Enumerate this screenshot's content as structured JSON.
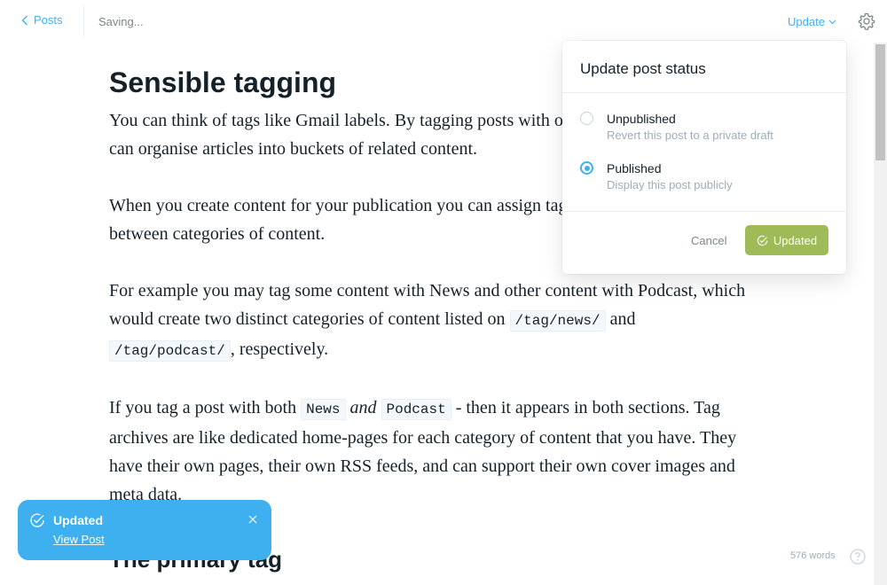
{
  "header": {
    "back_label": "Posts",
    "status_text": "Saving...",
    "update_label": "Update"
  },
  "post": {
    "title": "Sensible tagging",
    "paragraphs": {
      "p1": "You can think of tags like Gmail labels. By tagging posts with one or more keywords, you can organise articles into buckets of related content.",
      "p2": "When you create content for your publication you can assign tags to help differentiate between categories of content.",
      "p3_a": "For example you may tag some content with News and other content with Podcast, which would create two distinct categories of content listed on ",
      "p3_code1": "/tag/news/",
      "p3_b": " and ",
      "p3_code2": "/tag/podcast/",
      "p3_c": ", respectively.",
      "p4_a": "If you tag a post with both ",
      "p4_code1": "News",
      "p4_em": "and",
      "p4_code2": "Podcast",
      "p4_b": " - then it appears in both sections. Tag archives are like dedicated home-pages for each category of content that you have. They have their own pages, their own RSS feeds, and can support their own cover images and meta data."
    },
    "subheading": "The primary tag"
  },
  "popup": {
    "title": "Update post status",
    "options": [
      {
        "label": "Unpublished",
        "description": "Revert this post to a private draft",
        "selected": false
      },
      {
        "label": "Published",
        "description": "Display this post publicly",
        "selected": true
      }
    ],
    "cancel_label": "Cancel",
    "confirm_label": "Updated"
  },
  "toast": {
    "title": "Updated",
    "link": "View Post"
  },
  "footer": {
    "word_count": "576 words"
  },
  "icons": {
    "back": "chevron-left-icon",
    "dropdown": "chevron-down-icon",
    "settings": "gear-icon",
    "check": "check-circle-icon",
    "close": "close-icon",
    "help": "question-circle-icon"
  },
  "colors": {
    "accent": "#3eb0ef",
    "success": "#9fbb58",
    "text": "#15212a",
    "muted": "#9baeb8"
  }
}
